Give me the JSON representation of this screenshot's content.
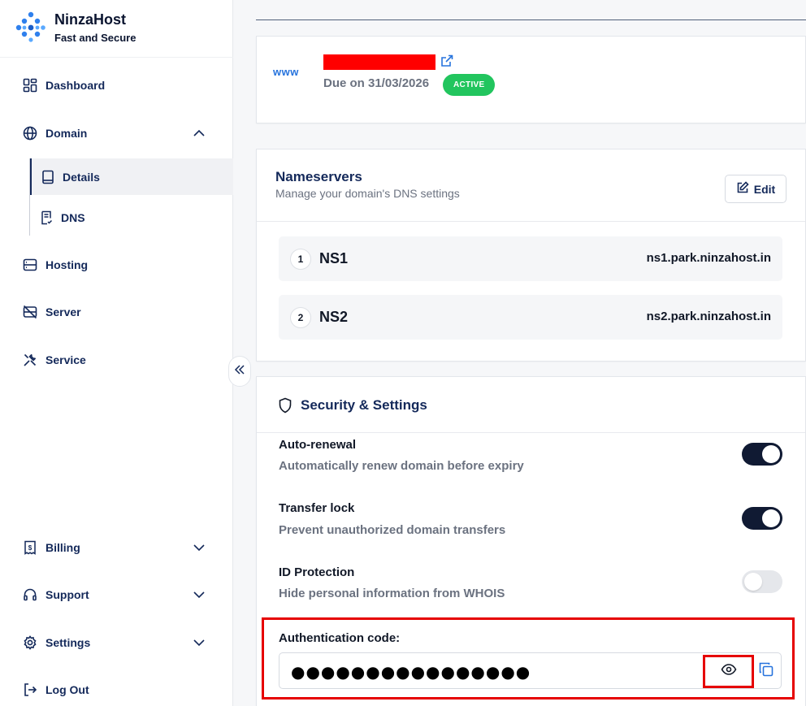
{
  "brand": {
    "name": "NinzaHost",
    "tagline": "Fast and Secure"
  },
  "sidebar": {
    "items": [
      {
        "label": "Dashboard"
      },
      {
        "label": "Domain"
      },
      {
        "label": "Hosting"
      },
      {
        "label": "Server"
      },
      {
        "label": "Service"
      },
      {
        "label": "Billing"
      },
      {
        "label": "Support"
      },
      {
        "label": "Settings"
      },
      {
        "label": "Log Out"
      }
    ],
    "domain_sub": [
      {
        "label": "Details",
        "active": true
      },
      {
        "label": "DNS",
        "active": false
      }
    ]
  },
  "domain_card": {
    "prefix_icon_text": "www",
    "due": "Due on 31/03/2026",
    "status": "ACTIVE",
    "status_color": "#22c55e"
  },
  "nameservers": {
    "title": "Nameservers",
    "subtitle": "Manage your domain's DNS settings",
    "edit_label": "Edit",
    "rows": [
      {
        "num": "1",
        "name": "NS1",
        "value": "ns1.park.ninzahost.in"
      },
      {
        "num": "2",
        "name": "NS2",
        "value": "ns2.park.ninzahost.in"
      }
    ]
  },
  "security": {
    "title": "Security & Settings",
    "settings": [
      {
        "title": "Auto-renewal",
        "desc": "Automatically renew domain before expiry",
        "enabled": true
      },
      {
        "title": "Transfer lock",
        "desc": "Prevent unauthorized domain transfers",
        "enabled": true
      },
      {
        "title": "ID Protection",
        "desc": "Hide personal information from WHOIS",
        "enabled": false
      }
    ],
    "auth_label": "Authentication code:",
    "auth_masked": "●●●●●●●●●●●●●●●●"
  },
  "colors": {
    "accent": "#14295a",
    "link": "#2673dd",
    "highlight": "#e60000"
  }
}
